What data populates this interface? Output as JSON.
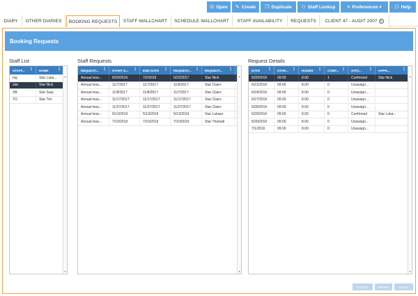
{
  "toolbar": {
    "items": [
      {
        "label": "Open",
        "icon": "open-icon",
        "glyph": "⊡"
      },
      {
        "label": "Create",
        "icon": "create-icon",
        "glyph": "✎"
      },
      {
        "label": "Duplicate",
        "icon": "duplicate-icon",
        "glyph": "❐"
      },
      {
        "label": "Staff Lookup",
        "icon": "staff-lookup-icon",
        "glyph": "⚇"
      },
      {
        "label": "Preferences ▾",
        "icon": "preferences-icon",
        "glyph": "≡"
      },
      {
        "label": "Help",
        "icon": "help-icon",
        "glyph": "☐"
      }
    ]
  },
  "tabs": [
    {
      "label": "DIARY"
    },
    {
      "label": "OTHER DIARIES"
    },
    {
      "label": "BOOKING REQUESTS"
    },
    {
      "label": "STAFF WALLCHART"
    },
    {
      "label": "SCHEDULE WALLCHART"
    },
    {
      "label": "STAFF AVAILABILITY"
    },
    {
      "label": "REQUESTS"
    },
    {
      "label": "CLIENT 47 - AUDIT 2007",
      "close": "×"
    }
  ],
  "active_tab": "BOOKING REQUESTS",
  "panel": {
    "title": "Booking Requests"
  },
  "staff_list": {
    "title": "Staff List",
    "columns": [
      "STAFF...",
      "NAME"
    ],
    "rows": [
      [
        "mg",
        "Star Luka..."
      ],
      [
        "star",
        "Star Nick"
      ],
      [
        "SB",
        "Star Sanj"
      ],
      [
        "TO",
        "Star Tim"
      ]
    ],
    "selected_row": 1
  },
  "staff_requests": {
    "title": "Staff Requests",
    "columns": [
      "REQUEST...",
      "START D...",
      "END DATE",
      "REQUEST...",
      "REQUEST..."
    ],
    "rows": [
      [
        "Annual leav...",
        "6/20/2016",
        "7/2/2016",
        "5/22/2017",
        "Star Nick"
      ],
      [
        "Annual leav...",
        "11/7/2017",
        "11/7/2017",
        "11/6/2017",
        "Star Claire"
      ],
      [
        "Annual leav...",
        "11/8/2017",
        "11/8/2017",
        "11/7/2017",
        "Star Claire"
      ],
      [
        "Annual leav...",
        "11/17/2017",
        "11/17/2017",
        "11/17/2017",
        "Star Claire"
      ],
      [
        "Annual leav...",
        "11/27/2017",
        "11/27/2017",
        "11/27/2017",
        "Star Claire"
      ],
      [
        "Annual leav...",
        "5/13/2019",
        "5/13/2019",
        "5/13/2019",
        "Star Lukasz"
      ],
      [
        "Annual leav...",
        "7/10/2019",
        "7/10/2019",
        "7/10/2019",
        "Star Thamali"
      ]
    ],
    "selected_row": 0
  },
  "request_details": {
    "title": "Request Details",
    "columns": [
      "DATE",
      "STAR...",
      "HOURS",
      "CONF...",
      "STAT...",
      "APPR..."
    ],
    "rows": [
      [
        "6/20/2016",
        "09:00",
        "8.00",
        "1",
        "Confirmed",
        "Star Nick"
      ],
      [
        "6/21/2016",
        "09:00",
        "8.00",
        "0",
        "Unassign...",
        ""
      ],
      [
        "6/24/2016",
        "09:00",
        "8.00",
        "0",
        "Unassign...",
        ""
      ],
      [
        "6/27/2016",
        "09:00",
        "8.00",
        "0",
        "Unassign...",
        ""
      ],
      [
        "6/28/2016",
        "09:00",
        "8.00",
        "0",
        "Unassign...",
        ""
      ],
      [
        "6/29/2016",
        "09:00",
        "8.00",
        "0",
        "Confirmed",
        "Star Luka..."
      ],
      [
        "6/30/2016",
        "09:00",
        "8.00",
        "0",
        "Unassign...",
        ""
      ],
      [
        "7/1/2016",
        "09:00",
        "8.00",
        "0",
        "Unassign...",
        ""
      ]
    ],
    "selected_row": 0
  },
  "footer": {
    "confirm": "Confirm",
    "revoke": "Revoke",
    "reject": "Reject"
  },
  "colors": {
    "accent": "#5aa3e0",
    "header_blue": "#3a7fc2",
    "selected_row": "#2e3b4a",
    "tab_active_border": "#f0a040"
  }
}
